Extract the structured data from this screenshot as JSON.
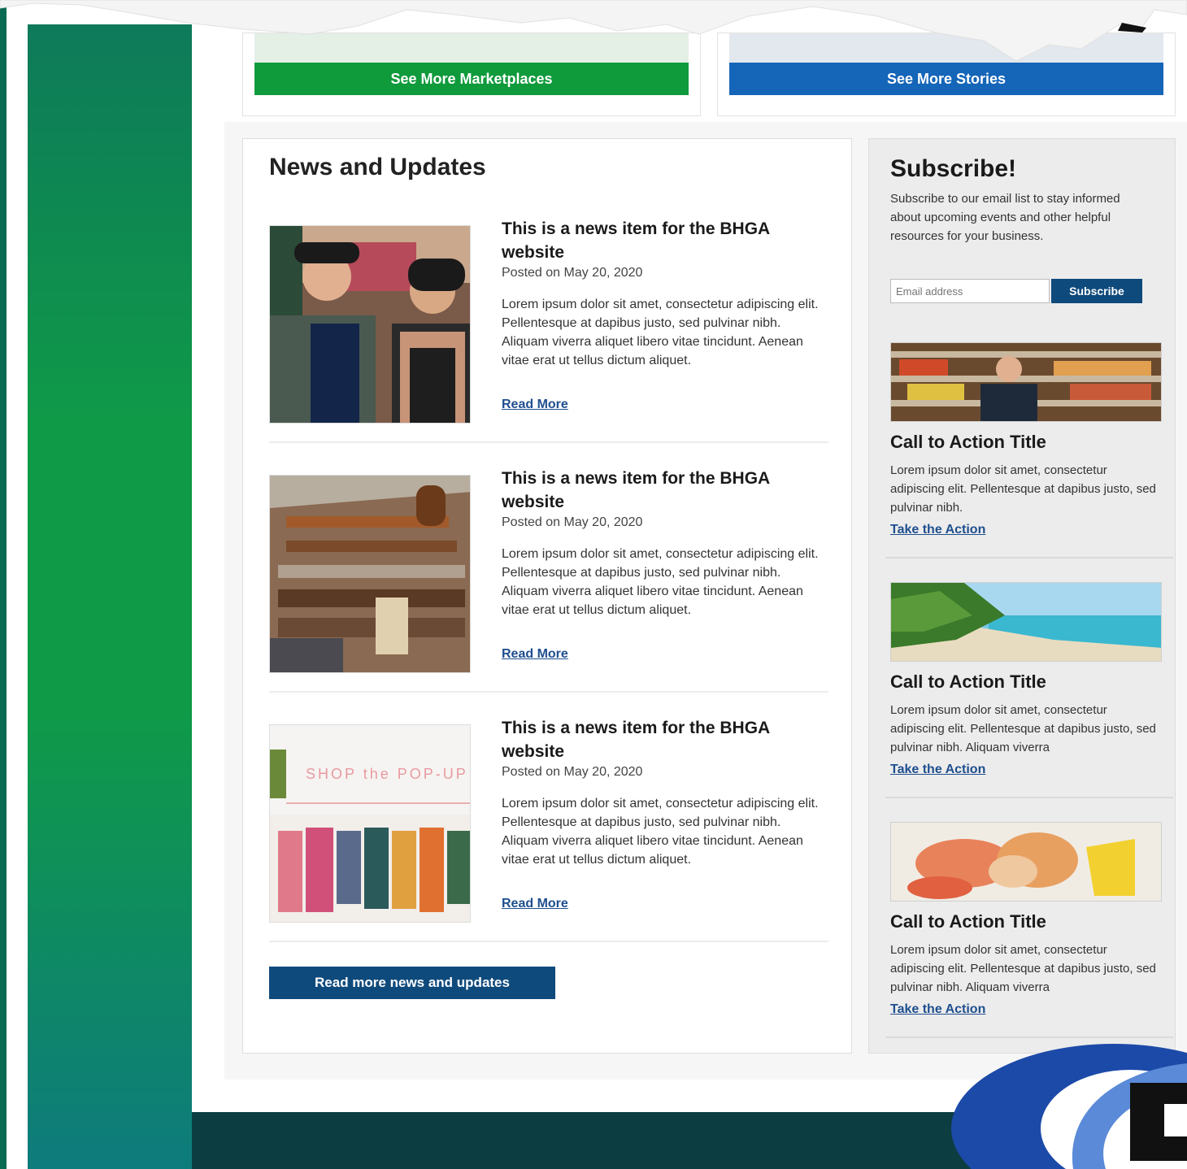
{
  "top_cards": {
    "left_button": "See More Marketplaces",
    "right_button": "See More Stories"
  },
  "news": {
    "heading": "News and Updates",
    "items": [
      {
        "title": "This is a news item for the BHGA website",
        "date": "Posted on May 20, 2020",
        "body": "Lorem ipsum dolor sit amet, consectetur adipiscing elit. Pellentesque at dapibus justo, sed pulvinar nibh. Aliquam viverra aliquet libero vitae tincidunt. Aenean vitae erat ut tellus dictum aliquet.",
        "link": "Read More",
        "image": "couple-photo"
      },
      {
        "title": "This is a news item for the BHGA website",
        "date": "Posted on May 20, 2020",
        "body": "Lorem ipsum dolor sit amet, consectetur adipiscing elit. Pellentesque at dapibus justo, sed pulvinar nibh. Aliquam viverra aliquet libero vitae tincidunt. Aenean vitae erat ut tellus dictum aliquet.",
        "link": "Read More",
        "image": "store-aisle-photo"
      },
      {
        "title": "This is a news item for the BHGA website",
        "date": "Posted on May 20, 2020",
        "body": "Lorem ipsum dolor sit amet, consectetur adipiscing elit. Pellentesque at dapibus justo, sed pulvinar nibh. Aliquam viverra aliquet libero vitae tincidunt. Aenean vitae erat ut tellus dictum aliquet.",
        "link": "Read More",
        "image": "clothing-popup-photo",
        "sign_text": "SHOP the POP-UP"
      }
    ],
    "read_all_button": "Read more news and updates"
  },
  "sidebar": {
    "heading": "Subscribe!",
    "intro": "Subscribe to our email list to stay informed about upcoming events and other helpful resources for your business.",
    "email_placeholder": "Email address",
    "subscribe_button": "Subscribe",
    "ctas": [
      {
        "title": "Call to Action Title",
        "body": "Lorem ipsum dolor sit amet, consectetur adipiscing elit. Pellentesque at dapibus justo, sed pulvinar nibh.",
        "link": "Take the Action",
        "image": "grocery-shelf-photo"
      },
      {
        "title": "Call to Action Title",
        "body": "Lorem ipsum dolor sit amet, consectetur adipiscing elit. Pellentesque at dapibus justo, sed pulvinar nibh. Aliquam viverra",
        "link": "Take the Action",
        "image": "beach-photo"
      },
      {
        "title": "Call to Action Title",
        "body": "Lorem ipsum dolor sit amet, consectetur adipiscing elit. Pellentesque at dapibus justo, sed pulvinar nibh. Aliquam viverra",
        "link": "Take the Action",
        "image": "seafood-photo"
      }
    ]
  },
  "colors": {
    "green_button": "#0f9a3c",
    "blue_button": "#1565b8",
    "navy": "#0f4a7c",
    "link": "#1f4f8f",
    "footer": "#0c3d40"
  }
}
